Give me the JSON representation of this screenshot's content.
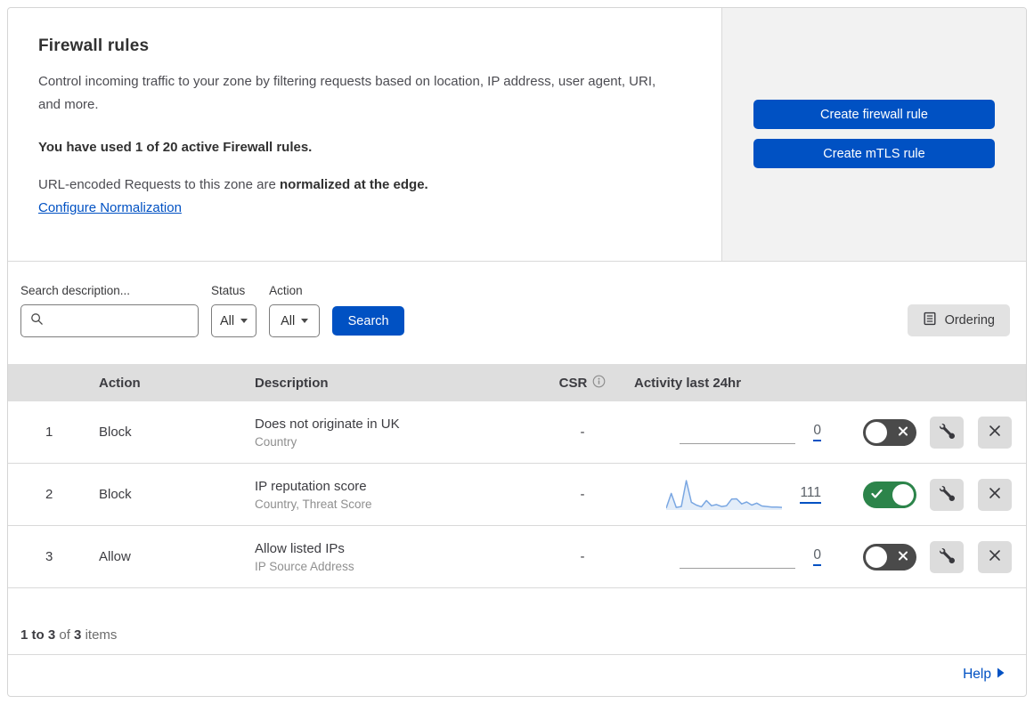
{
  "header": {
    "title": "Firewall rules",
    "description": "Control incoming traffic to your zone by filtering requests based on location, IP address, user agent, URI, and more.",
    "usage_text": "You have used 1 of 20 active Firewall rules.",
    "normalization_text": "URL-encoded Requests to this zone are ",
    "normalization_bold": "normalized at the edge.",
    "normalization_link": "Configure Normalization",
    "create_firewall_label": "Create firewall rule",
    "create_mtls_label": "Create mTLS rule"
  },
  "filters": {
    "search_label": "Search description...",
    "status_label": "Status",
    "status_value": "All",
    "action_label": "Action",
    "action_value": "All",
    "search_button_label": "Search",
    "ordering_button_label": "Ordering"
  },
  "table": {
    "columns": {
      "action": "Action",
      "description": "Description",
      "csr": "CSR",
      "activity": "Activity last 24hr"
    },
    "rows": [
      {
        "num": "1",
        "action": "Block",
        "description": "Does not originate in UK",
        "fields": "Country",
        "csr": "-",
        "activity_count": "0",
        "enabled": false
      },
      {
        "num": "2",
        "action": "Block",
        "description": "IP reputation score",
        "fields": "Country, Threat Score",
        "csr": "-",
        "activity_count": "111",
        "enabled": true
      },
      {
        "num": "3",
        "action": "Allow",
        "description": "Allow listed IPs",
        "fields": "IP Source Address",
        "csr": "-",
        "activity_count": "0",
        "enabled": false
      }
    ]
  },
  "chart_data": {
    "type": "area",
    "title": "Activity last 24hr sparkline for rule 2 (total 111 events)",
    "values": [
      3,
      55,
      6,
      9,
      100,
      24,
      14,
      8,
      30,
      12,
      16,
      9,
      12,
      35,
      36,
      18,
      25,
      14,
      21,
      11,
      9,
      7,
      7,
      6
    ],
    "ylim": [
      0,
      100
    ],
    "line_color": "#7aa7e2",
    "fill_color": "#e3edf9"
  },
  "pagination": {
    "range": "1 to 3",
    "of_text": "of",
    "total": "3",
    "items_text": "items"
  },
  "footer": {
    "help_label": "Help"
  },
  "colors": {
    "accent_blue": "#0051c3",
    "toggle_on_green": "#2c844a",
    "toggle_off_gray": "#4a4a4a",
    "table_header_bg": "#dedede",
    "panel_bg": "#f2f2f2"
  }
}
